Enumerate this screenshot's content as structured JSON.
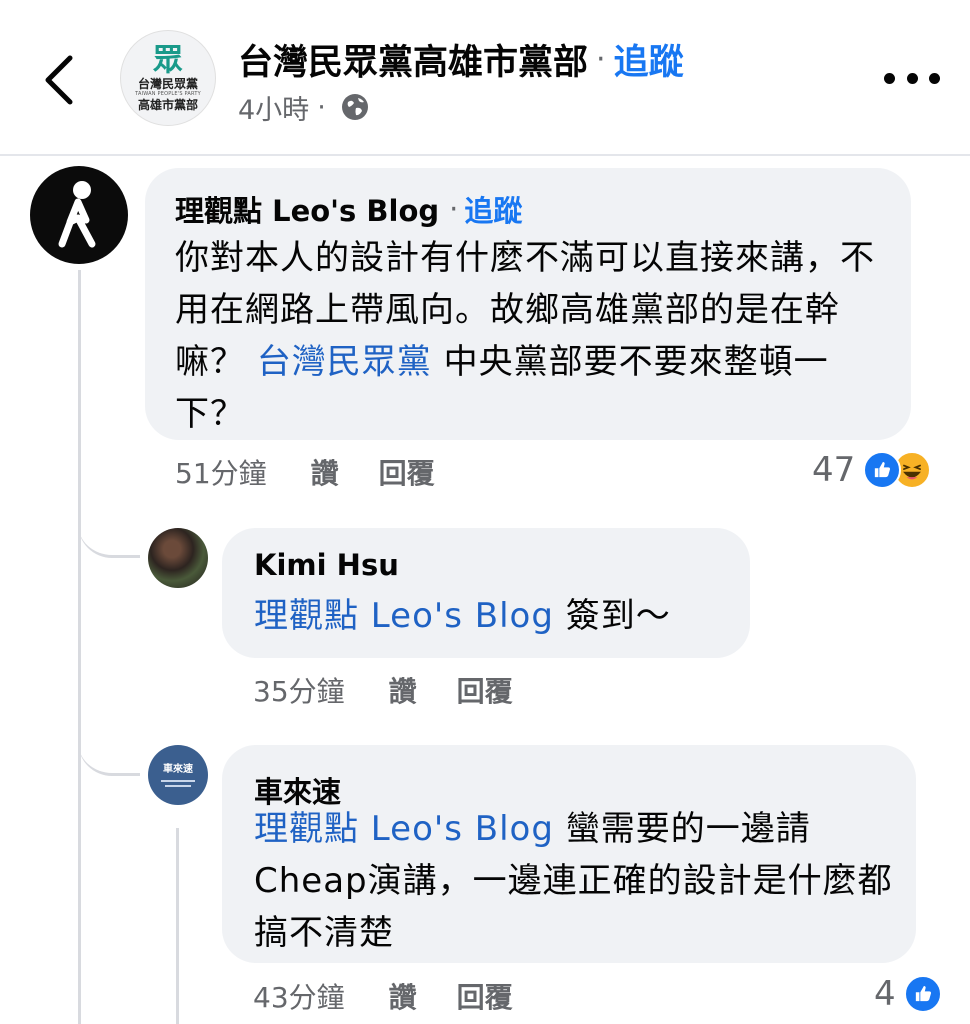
{
  "header": {
    "page_name": "台灣民眾黨高雄市黨部",
    "separator": "·",
    "follow_label": "追蹤",
    "post_time": "4小時",
    "time_separator": "·",
    "avatar": {
      "mark": "眾",
      "line1": "台灣民眾黨",
      "line2": "TAIWAN PEOPLE'S PARTY",
      "line3": "高雄市黨部"
    }
  },
  "comments": [
    {
      "author": "理觀點 Leo's Blog",
      "separator": "·",
      "follow_label": "追蹤",
      "text_before": "你對本人的設計有什麼不滿可以直接來講，不用在網路上帶風向。故鄉高雄黨部的是在幹嘛？ ",
      "mention": "台灣民眾黨",
      "text_after": " 中央黨部要不要來整頓一下？",
      "time": "51分鐘",
      "like_label": "讚",
      "reply_label": "回覆",
      "reaction_count": "47",
      "reactions": [
        "like",
        "haha"
      ]
    },
    {
      "author": "Kimi Hsu",
      "mention": "理觀點 Leo's Blog",
      "text_after": " 簽到～",
      "time": "35分鐘",
      "like_label": "讚",
      "reply_label": "回覆"
    },
    {
      "author": "車來速",
      "avatar_text": "車來速",
      "mention": "理觀點 Leo's Blog",
      "text_after": " 蠻需要的一邊請Cheap演講，一邊連正確的設計是什麼都搞不清楚",
      "time": "43分鐘",
      "like_label": "讚",
      "reply_label": "回覆",
      "reaction_count": "4",
      "reactions": [
        "like"
      ]
    }
  ],
  "colors": {
    "accent": "#1877f2",
    "mention": "#1f62c4",
    "secondary_text": "#65676b",
    "bubble": "#f0f2f5"
  }
}
